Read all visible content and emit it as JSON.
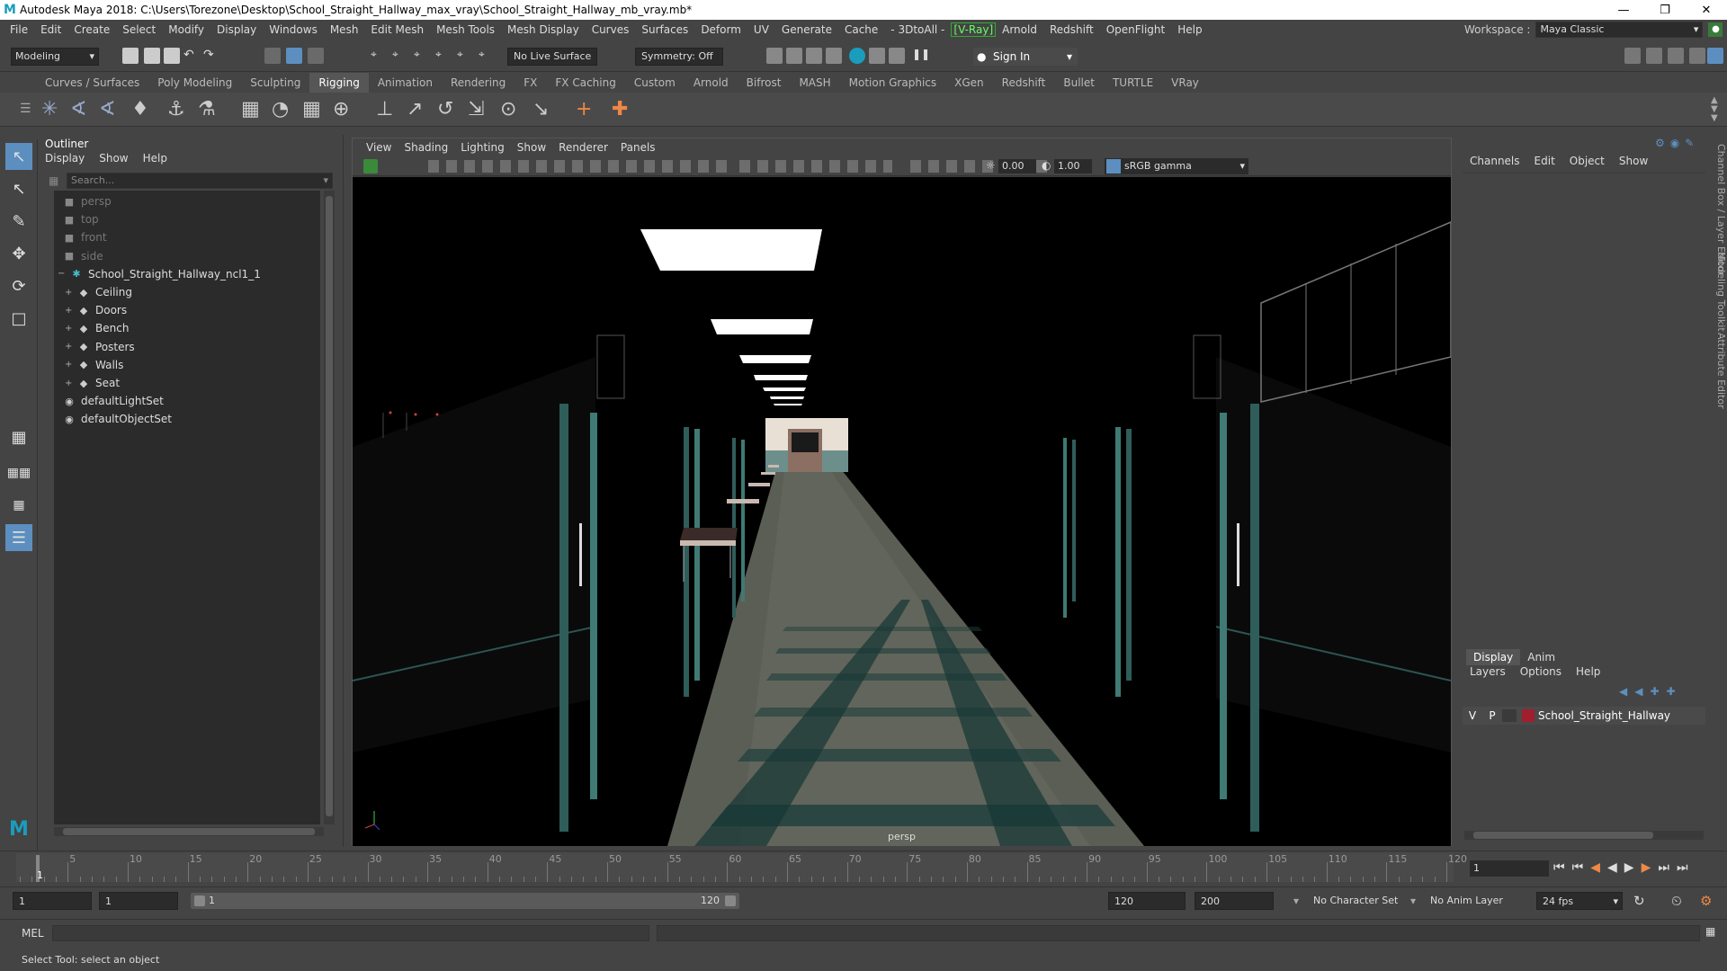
{
  "window": {
    "title": "Autodesk Maya 2018: C:\\Users\\Torezone\\Desktop\\School_Straight_Hallway_max_vray\\School_Straight_Hallway_mb_vray.mb*",
    "logo": "M"
  },
  "menubar": {
    "items": [
      "File",
      "Edit",
      "Create",
      "Select",
      "Modify",
      "Display",
      "Windows",
      "Mesh",
      "Edit Mesh",
      "Mesh Tools",
      "Mesh Display",
      "Curves",
      "Surfaces",
      "Deform",
      "UV",
      "Generate",
      "Cache",
      "- 3DtoAll -",
      "[V-Ray]",
      "Arnold",
      "Redshift",
      "OpenFlight",
      "Help"
    ],
    "workspace_label": "Workspace :",
    "workspace_value": "Maya Classic"
  },
  "statusline": {
    "mode": "Modeling",
    "live_surface": "No Live Surface",
    "symmetry": "Symmetry: Off",
    "sign_in": "Sign In"
  },
  "shelf": {
    "tabs": [
      "Curves / Surfaces",
      "Poly Modeling",
      "Sculpting",
      "Rigging",
      "Animation",
      "Rendering",
      "FX",
      "FX Caching",
      "Custom",
      "Arnold",
      "Bifrost",
      "MASH",
      "Motion Graphics",
      "XGen",
      "Redshift",
      "Bullet",
      "TURTLE",
      "VRay"
    ],
    "active_tab": "Rigging"
  },
  "outliner": {
    "title": "Outliner",
    "menu": [
      "Display",
      "Show",
      "Help"
    ],
    "search_placeholder": "Search...",
    "items": [
      {
        "label": "persp",
        "icon": "camera-icon",
        "indent": 1,
        "dim": true
      },
      {
        "label": "top",
        "icon": "camera-icon",
        "indent": 1,
        "dim": true
      },
      {
        "label": "front",
        "icon": "camera-icon",
        "indent": 1,
        "dim": true
      },
      {
        "label": "side",
        "icon": "camera-icon",
        "indent": 1,
        "dim": true
      },
      {
        "label": "School_Straight_Hallway_ncl1_1",
        "icon": "group-icon",
        "indent": 0,
        "expand": "−"
      },
      {
        "label": "Ceiling",
        "icon": "mesh-icon",
        "indent": 2,
        "expand": "+"
      },
      {
        "label": "Doors",
        "icon": "mesh-icon",
        "indent": 2,
        "expand": "+"
      },
      {
        "label": "Bench",
        "icon": "mesh-icon",
        "indent": 2,
        "expand": "+"
      },
      {
        "label": "Posters",
        "icon": "mesh-icon",
        "indent": 2,
        "expand": "+"
      },
      {
        "label": "Walls",
        "icon": "mesh-icon",
        "indent": 2,
        "expand": "+"
      },
      {
        "label": "Seat",
        "icon": "mesh-icon",
        "indent": 2,
        "expand": "+"
      },
      {
        "label": "defaultLightSet",
        "icon": "set-icon",
        "indent": 1
      },
      {
        "label": "defaultObjectSet",
        "icon": "set-icon",
        "indent": 1
      }
    ]
  },
  "viewport": {
    "menu": [
      "View",
      "Shading",
      "Lighting",
      "Show",
      "Renderer",
      "Panels"
    ],
    "exposure": "0.00",
    "gamma": "1.00",
    "color_space": "sRGB gamma",
    "camera_label": "persp"
  },
  "channel_box": {
    "menu": [
      "Channels",
      "Edit",
      "Object",
      "Show"
    ],
    "side_tabs": [
      "Channel Box / Layer Editor",
      "Modeling Toolkit",
      "Attribute Editor"
    ]
  },
  "layer_editor": {
    "tabs": [
      "Display",
      "Anim"
    ],
    "active_tab": "Display",
    "menu": [
      "Layers",
      "Options",
      "Help"
    ],
    "layers": [
      {
        "v": "V",
        "p": "P",
        "name": "School_Straight_Hallway",
        "color": "#a01e2e"
      }
    ]
  },
  "timeline": {
    "ticks": [
      "5",
      "10",
      "15",
      "20",
      "25",
      "30",
      "35",
      "40",
      "45",
      "50",
      "55",
      "60",
      "65",
      "70",
      "75",
      "80",
      "85",
      "90",
      "95",
      "100",
      "105",
      "110",
      "115",
      "120"
    ],
    "current_frame_marker": "1",
    "current_frame": "1"
  },
  "range": {
    "start": "1",
    "playback_start": "1",
    "slider_start": "1",
    "slider_end": "120",
    "playback_end": "120",
    "end": "200",
    "character_set": "No Character Set",
    "anim_layer": "No Anim Layer",
    "fps": "24 fps"
  },
  "command_line": {
    "label": "MEL"
  },
  "help_line": "Select Tool: select an object"
}
